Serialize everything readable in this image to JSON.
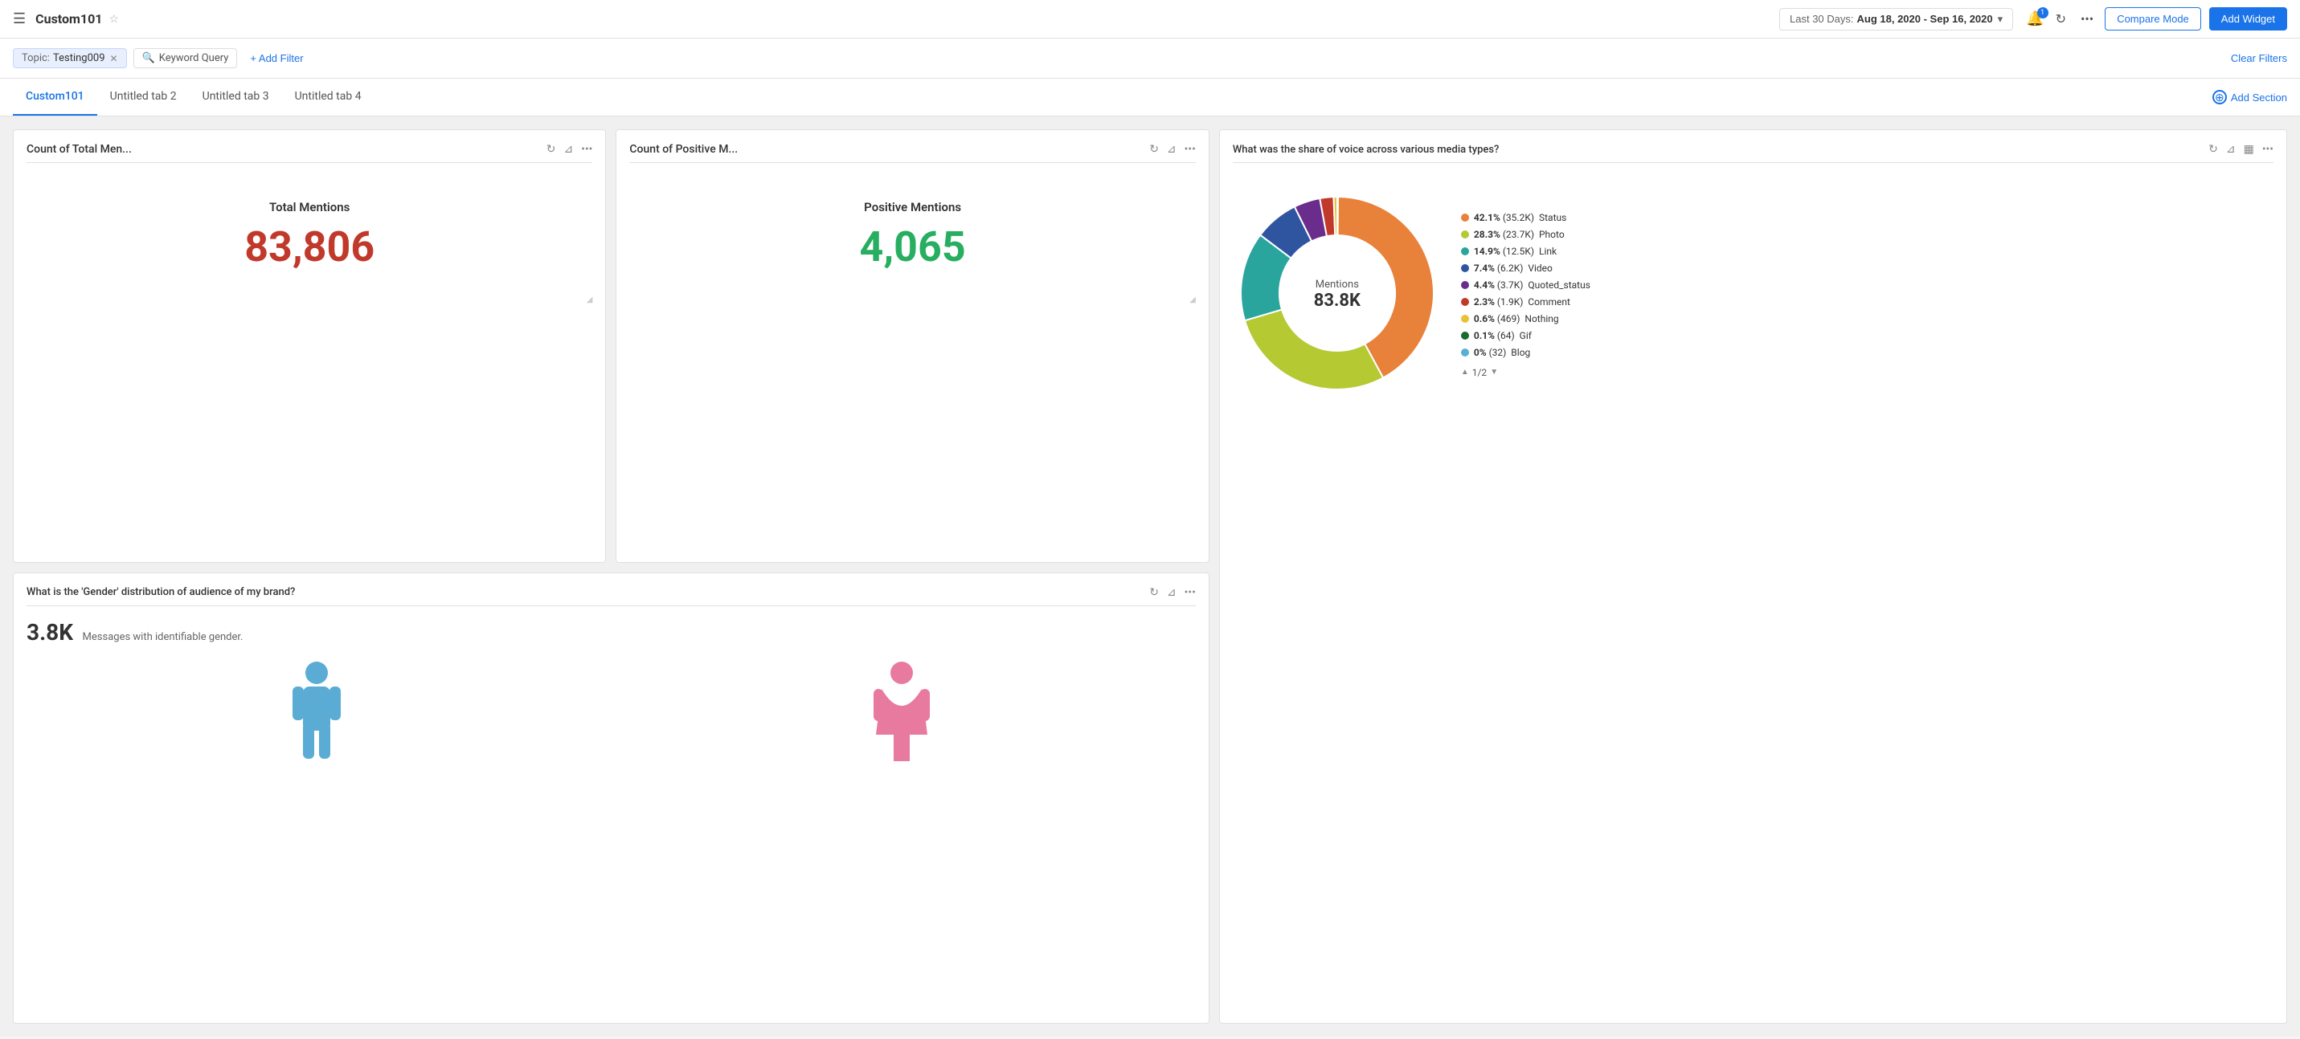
{
  "header": {
    "menu_icon": "☰",
    "title": "Custom101",
    "star_icon": "☆",
    "date_range": {
      "label": "Last 30 Days:",
      "value": "Aug 18, 2020 - Sep 16, 2020",
      "chevron": "▾"
    },
    "notif_count": "1",
    "compare_label": "Compare Mode",
    "add_widget_label": "Add Widget"
  },
  "filter_bar": {
    "topic_label": "Topic:",
    "topic_value": "Testing009",
    "keyword_label": "Keyword Query",
    "add_filter_label": "+ Add Filter",
    "clear_filters_label": "Clear Filters"
  },
  "tabs": [
    {
      "label": "Custom101",
      "active": true
    },
    {
      "label": "Untitled tab 2",
      "active": false
    },
    {
      "label": "Untitled tab 3",
      "active": false
    },
    {
      "label": "Untitled tab 4",
      "active": false
    }
  ],
  "add_section_label": "Add Section",
  "widgets": {
    "total_mentions": {
      "title": "Count of Total Men...",
      "label": "Total Mentions",
      "value": "83,806",
      "color": "red"
    },
    "positive_mentions": {
      "title": "Count of Positive M...",
      "label": "Positive Mentions",
      "value": "4,065",
      "color": "green"
    },
    "gender": {
      "title": "What is the 'Gender' distribution of audience of my brand?",
      "count": "3.8K",
      "subtitle": "Messages with identifiable gender."
    },
    "share_of_voice": {
      "title": "What was the share of voice across various media types?",
      "center_label": "Mentions",
      "center_value": "83.8K",
      "legend": [
        {
          "pct": "42.1%",
          "count": "(35.2K)",
          "label": "Status",
          "color": "#e8813a"
        },
        {
          "pct": "28.3%",
          "count": "(23.7K)",
          "label": "Photo",
          "color": "#b5c933"
        },
        {
          "pct": "14.9%",
          "count": "(12.5K)",
          "label": "Link",
          "color": "#2aa59e"
        },
        {
          "pct": "7.4%",
          "count": "(6.2K)",
          "label": "Video",
          "color": "#3055a0"
        },
        {
          "pct": "4.4%",
          "count": "(3.7K)",
          "label": "Quoted_status",
          "color": "#6b2d8b"
        },
        {
          "pct": "2.3%",
          "count": "(1.9K)",
          "label": "Comment",
          "color": "#c0392b"
        },
        {
          "pct": "0.6%",
          "count": "(469)",
          "label": "Nothing",
          "color": "#e8c233"
        },
        {
          "pct": "0.1%",
          "count": "(64)",
          "label": "Gif",
          "color": "#1a6b2f"
        },
        {
          "pct": "0%",
          "count": "(32)",
          "label": "Blog",
          "color": "#5aaed4"
        }
      ],
      "pagination": "1/2",
      "donut_segments": [
        {
          "pct": 42.1,
          "color": "#e8813a"
        },
        {
          "pct": 28.3,
          "color": "#b5c933"
        },
        {
          "pct": 14.9,
          "color": "#2aa59e"
        },
        {
          "pct": 7.4,
          "color": "#3055a0"
        },
        {
          "pct": 4.4,
          "color": "#6b2d8b"
        },
        {
          "pct": 2.3,
          "color": "#c0392b"
        },
        {
          "pct": 0.6,
          "color": "#e8c233"
        },
        {
          "pct": 0.1,
          "color": "#1a6b2f"
        },
        {
          "pct": 0.0384,
          "color": "#5aaed4"
        }
      ]
    }
  }
}
